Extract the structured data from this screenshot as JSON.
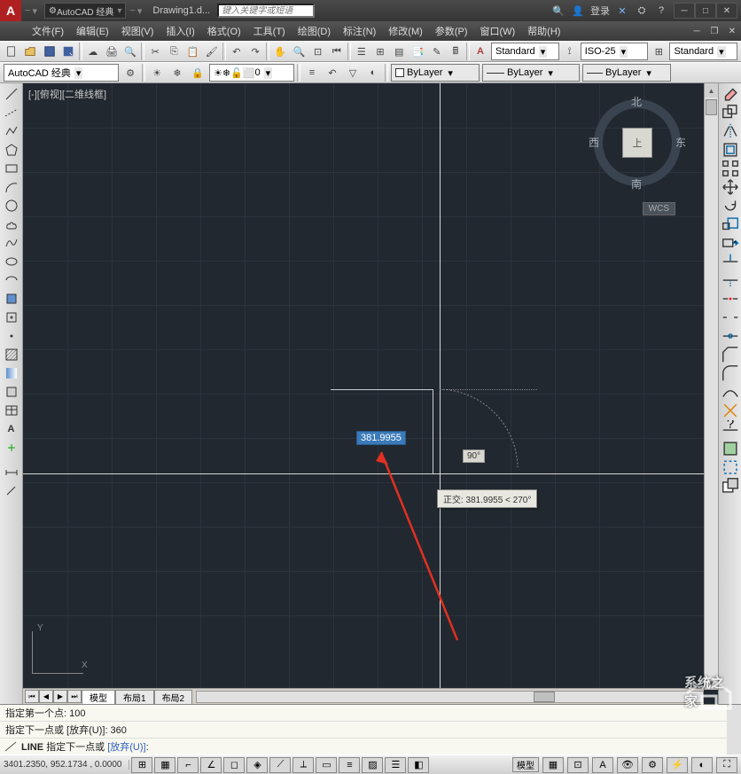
{
  "title": {
    "workspace_combo": "AutoCAD 经典",
    "filename": "Drawing1.d...",
    "search_placeholder": "键入关键字或短语",
    "login": "登录"
  },
  "menus": [
    "文件(F)",
    "编辑(E)",
    "视图(V)",
    "插入(I)",
    "格式(O)",
    "工具(T)",
    "绘图(D)",
    "标注(N)",
    "修改(M)",
    "参数(P)",
    "窗口(W)",
    "帮助(H)"
  ],
  "toolbar2": {
    "workspace": "AutoCAD 经典",
    "layer_state": "0",
    "textstyle": "Standard",
    "dimstyle": "ISO-25",
    "tablestyle": "Standard",
    "layer_prop": "ByLayer",
    "linetype": "ByLayer",
    "lineweight": "ByLayer"
  },
  "viewport": {
    "label": "[-][俯视][二维线框]",
    "wcs": "WCS",
    "cube_top": "上",
    "dir_n": "北",
    "dir_s": "南",
    "dir_e": "东",
    "dir_w": "西",
    "axis_x": "X",
    "axis_y": "Y"
  },
  "drawing": {
    "dim_value": "381.9955",
    "angle": "90°",
    "tooltip": "正交: 381.9955 < 270°"
  },
  "layout_tabs": [
    "模型",
    "布局1",
    "布局2"
  ],
  "command": {
    "history1": "指定第一个点: 100",
    "history2": "指定下一点或 [放弃(U)]: 360",
    "prompt_cmd": "LINE",
    "prompt_text": " 指定下一点或 ",
    "prompt_param": "[放弃(U)]",
    "prompt_colon": ":"
  },
  "status": {
    "coords": "3401.2350, 952.1734 , 0.0000",
    "mode": "模型"
  },
  "watermark": "系统之家"
}
